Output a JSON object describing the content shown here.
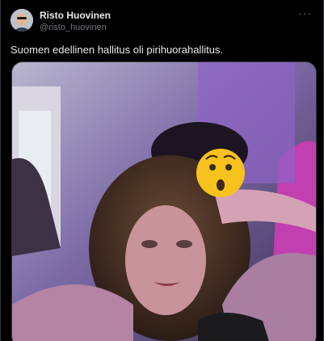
{
  "tweet": {
    "author_name": "Risto Huovinen",
    "author_handle": "@risto_huovinen",
    "more_icon": "more-horizontal-icon",
    "text": "Suomen edellinen hallitus oli pirihuorahallitus.",
    "media": {
      "overlay_emoji": "astonished-face-emoji"
    }
  },
  "colors": {
    "background": "#000000",
    "text_primary": "#e7e9ea",
    "text_secondary": "#71767b",
    "border": "#2f3336",
    "emoji_yellow": "#f7c21d"
  }
}
